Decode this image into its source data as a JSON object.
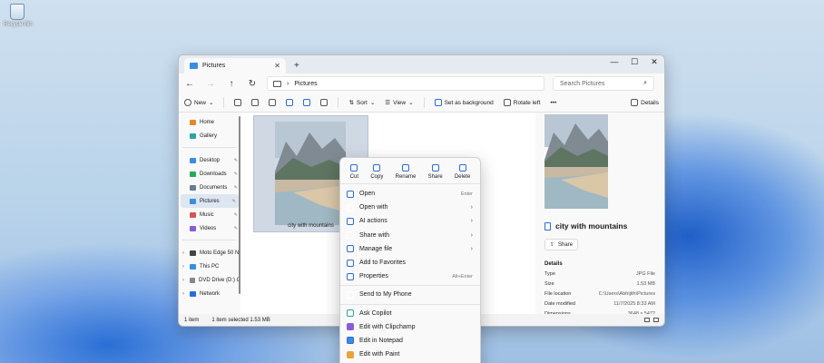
{
  "desktop": {
    "recycle_label": "Recycle Bin"
  },
  "window": {
    "tab_title": "Pictures",
    "new_tab": "+",
    "controls": {
      "minimize": "—",
      "maximize": "☐",
      "close": "✕"
    }
  },
  "addressbar": {
    "path": "Pictures",
    "search_placeholder": "Search Pictures"
  },
  "toolbar": {
    "new": "New",
    "sort": "Sort",
    "view": "View",
    "set_background": "Set as background",
    "rotate_left": "Rotate left",
    "more": "•••",
    "details": "Details"
  },
  "sidebar": {
    "quick": [
      {
        "label": "Home",
        "pinned": false
      },
      {
        "label": "Gallery",
        "pinned": false
      }
    ],
    "pinned": [
      {
        "label": "Desktop"
      },
      {
        "label": "Downloads"
      },
      {
        "label": "Documents"
      },
      {
        "label": "Pictures"
      },
      {
        "label": "Music"
      },
      {
        "label": "Videos"
      }
    ],
    "devices": [
      {
        "label": "Moto Edge 50 N"
      },
      {
        "label": "This PC"
      },
      {
        "label": "DVD Drive (D:) C"
      },
      {
        "label": "Network"
      }
    ]
  },
  "content": {
    "file_name": "city with mountains"
  },
  "preview": {
    "title": "city with mountains",
    "share_label": "Share",
    "details_heading": "Details",
    "rows": [
      {
        "k": "Type",
        "v": "JPG File"
      },
      {
        "k": "Size",
        "v": "1.53 MB"
      },
      {
        "k": "File location",
        "v": "C:\\Users\\Abhijith\\Pictures"
      },
      {
        "k": "Date modified",
        "v": "11/7/2025 8:33 AM"
      },
      {
        "k": "Dimensions",
        "v": "3648 x 5472"
      }
    ]
  },
  "status": {
    "count": "1 item",
    "selected": "1 item selected  1.53 MB"
  },
  "context_menu": {
    "quick_actions": [
      {
        "label": "Cut",
        "icon": "cut-icon"
      },
      {
        "label": "Copy",
        "icon": "copy-icon"
      },
      {
        "label": "Rename",
        "icon": "rename-icon"
      },
      {
        "label": "Share",
        "icon": "share-icon"
      },
      {
        "label": "Delete",
        "icon": "delete-icon"
      }
    ],
    "items": [
      {
        "label": "Open",
        "shortcut": "Enter"
      },
      {
        "label": "Open with",
        "submenu": true
      },
      {
        "label": "AI actions",
        "submenu": true
      },
      {
        "label": "Share with",
        "submenu": true
      },
      {
        "label": "Manage file",
        "submenu": true
      },
      {
        "label": "Add to Favorites"
      },
      {
        "label": "Properties",
        "shortcut": "Alt+Enter"
      },
      {
        "label": "Send to My Phone"
      },
      {
        "label": "Ask Copilot"
      },
      {
        "label": "Edit with Clipchamp"
      },
      {
        "label": "Edit in Notepad"
      },
      {
        "label": "Edit with Paint"
      }
    ]
  }
}
